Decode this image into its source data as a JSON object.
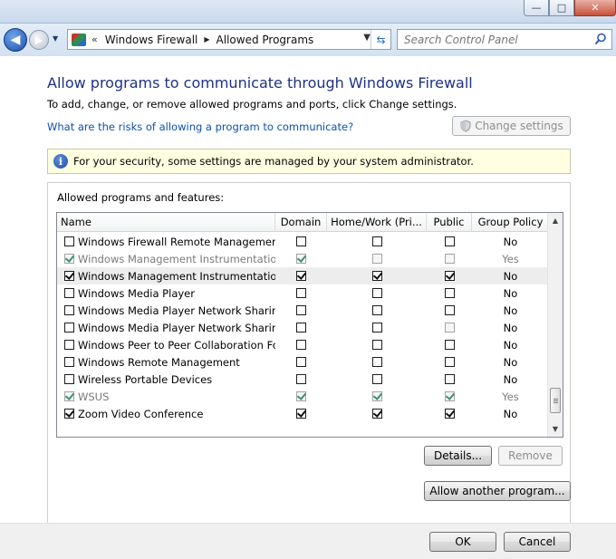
{
  "window": {
    "min_glyph": "—",
    "max_glyph": "□",
    "close_glyph": "✕"
  },
  "nav": {
    "back_glyph": "◀",
    "forward_glyph": "▶",
    "history_glyph": "▼",
    "overflow_glyph": "«",
    "breadcrumbs": [
      "Windows Firewall",
      "Allowed Programs"
    ],
    "crumb_separator_glyph": "▶",
    "dropdown_glyph": "▼",
    "refresh_glyph": "⇆"
  },
  "search": {
    "placeholder": "Search Control Panel"
  },
  "page": {
    "title": "Allow programs to communicate through Windows Firewall",
    "subtitle": "To add, change, or remove allowed programs and ports, click Change settings.",
    "risk_link": "What are the risks of allowing a program to communicate?",
    "change_settings_label": "Change settings",
    "info_glyph": "i",
    "info_text": "For your security, some settings are managed by your system administrator.",
    "group_label": "Allowed programs and features:",
    "details_label": "Details...",
    "remove_label": "Remove",
    "allow_another_label": "Allow another program...",
    "ok_label": "OK",
    "cancel_label": "Cancel"
  },
  "table": {
    "columns": [
      "Name",
      "Domain",
      "Home/Work (Pri...",
      "Public",
      "Group Policy"
    ],
    "rows": [
      {
        "name": "Windows Firewall Remote Management",
        "checked": false,
        "domain": false,
        "home": false,
        "public": false,
        "policy": "No",
        "gray": false,
        "selected": false,
        "public_disabled": false
      },
      {
        "name": "Windows Management Instrumentatio...",
        "checked": true,
        "domain": true,
        "home": false,
        "public": false,
        "policy": "Yes",
        "gray": true,
        "selected": false,
        "public_disabled": false
      },
      {
        "name": "Windows Management Instrumentatio...",
        "checked": true,
        "domain": true,
        "home": true,
        "public": true,
        "policy": "No",
        "gray": false,
        "selected": true,
        "public_disabled": false
      },
      {
        "name": "Windows Media Player",
        "checked": false,
        "domain": false,
        "home": false,
        "public": false,
        "policy": "No",
        "gray": false,
        "selected": false,
        "public_disabled": false
      },
      {
        "name": "Windows Media Player Network Sharin...",
        "checked": false,
        "domain": false,
        "home": false,
        "public": false,
        "policy": "No",
        "gray": false,
        "selected": false,
        "public_disabled": false
      },
      {
        "name": "Windows Media Player Network Sharin...",
        "checked": false,
        "domain": false,
        "home": false,
        "public": false,
        "policy": "No",
        "gray": false,
        "selected": false,
        "public_disabled": true
      },
      {
        "name": "Windows Peer to Peer Collaboration Fo...",
        "checked": false,
        "domain": false,
        "home": false,
        "public": false,
        "policy": "No",
        "gray": false,
        "selected": false,
        "public_disabled": false
      },
      {
        "name": "Windows Remote Management",
        "checked": false,
        "domain": false,
        "home": false,
        "public": false,
        "policy": "No",
        "gray": false,
        "selected": false,
        "public_disabled": false
      },
      {
        "name": "Wireless Portable Devices",
        "checked": false,
        "domain": false,
        "home": false,
        "public": false,
        "policy": "No",
        "gray": false,
        "selected": false,
        "public_disabled": false
      },
      {
        "name": "WSUS",
        "checked": true,
        "domain": true,
        "home": true,
        "public": true,
        "policy": "Yes",
        "gray": true,
        "selected": false,
        "public_disabled": false
      },
      {
        "name": "Zoom Video Conference",
        "checked": true,
        "domain": true,
        "home": true,
        "public": true,
        "policy": "No",
        "gray": false,
        "selected": false,
        "public_disabled": false
      }
    ]
  },
  "scroll": {
    "up_glyph": "▲",
    "down_glyph": "▼",
    "position": 0.95
  }
}
